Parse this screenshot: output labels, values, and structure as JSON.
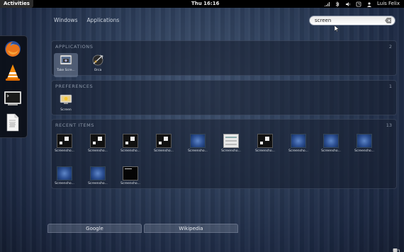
{
  "topbar": {
    "activities": "Activities",
    "clock": "Thu 16:16",
    "user": "Luis Felix",
    "tray_icons": [
      "network-signal-icon",
      "bluetooth-icon",
      "volume-icon",
      "keyboard-icon"
    ]
  },
  "view_tabs": [
    "Windows",
    "Applications"
  ],
  "search": {
    "value": "screen"
  },
  "dash": {
    "items": [
      "firefox-icon",
      "vlc-icon",
      "terminal-icon",
      "text-document-icon"
    ]
  },
  "sections": {
    "applications": {
      "title": "APPLICATIONS",
      "count": "2",
      "items": [
        {
          "label": "Take Scre...",
          "icon": "screenshot-app-icon",
          "selected": true
        },
        {
          "label": "Orca",
          "icon": "orca-screen-reader-icon",
          "selected": false
        }
      ]
    },
    "preferences": {
      "title": "PREFERENCES",
      "count": "1",
      "items": [
        {
          "label": "Screen",
          "icon": "screen-settings-icon"
        }
      ]
    },
    "recent": {
      "title": "RECENT ITEMS",
      "count": "13",
      "items": [
        {
          "label": "Screensho...",
          "kind": "dark"
        },
        {
          "label": "Screensho...",
          "kind": "dark"
        },
        {
          "label": "Screensho...",
          "kind": "dark"
        },
        {
          "label": "Screensho...",
          "kind": "dark"
        },
        {
          "label": "Screensho...",
          "kind": "blue"
        },
        {
          "label": "Screensho...",
          "kind": "light"
        },
        {
          "label": "Screensho...",
          "kind": "dark"
        },
        {
          "label": "Screensho...",
          "kind": "blue"
        },
        {
          "label": "Screensho...",
          "kind": "blue"
        },
        {
          "label": "Screensho...",
          "kind": "blue"
        },
        {
          "label": "Screensho...",
          "kind": "blue"
        },
        {
          "label": "Screensho...",
          "kind": "blue"
        },
        {
          "label": "Screensho...",
          "kind": "black"
        }
      ]
    }
  },
  "bottom_buttons": [
    "Google",
    "Wikipedia"
  ]
}
